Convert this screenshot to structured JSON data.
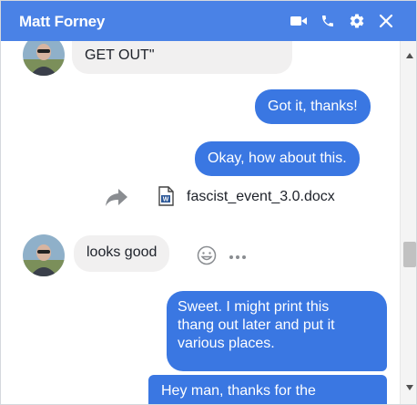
{
  "header": {
    "title": "Matt Forney",
    "icons": [
      "video-call-icon",
      "phone-icon",
      "settings-gear-icon",
      "close-icon"
    ],
    "bg_color": "#4a82e6"
  },
  "messages": {
    "incoming_1": "GET OUT\"",
    "outgoing_1": "Got it, thanks!",
    "outgoing_2": "Okay, how about this.",
    "file_name": "fascist_event_3.0.docx",
    "incoming_2": "looks good",
    "outgoing_3_lines": [
      "Sweet. I might print this",
      "thang out later and put it",
      "various places."
    ],
    "outgoing_4": "Hey man, thanks for the"
  },
  "colors": {
    "outgoing_bubble": "#3a77e2",
    "incoming_bubble": "#f1f0f0"
  }
}
